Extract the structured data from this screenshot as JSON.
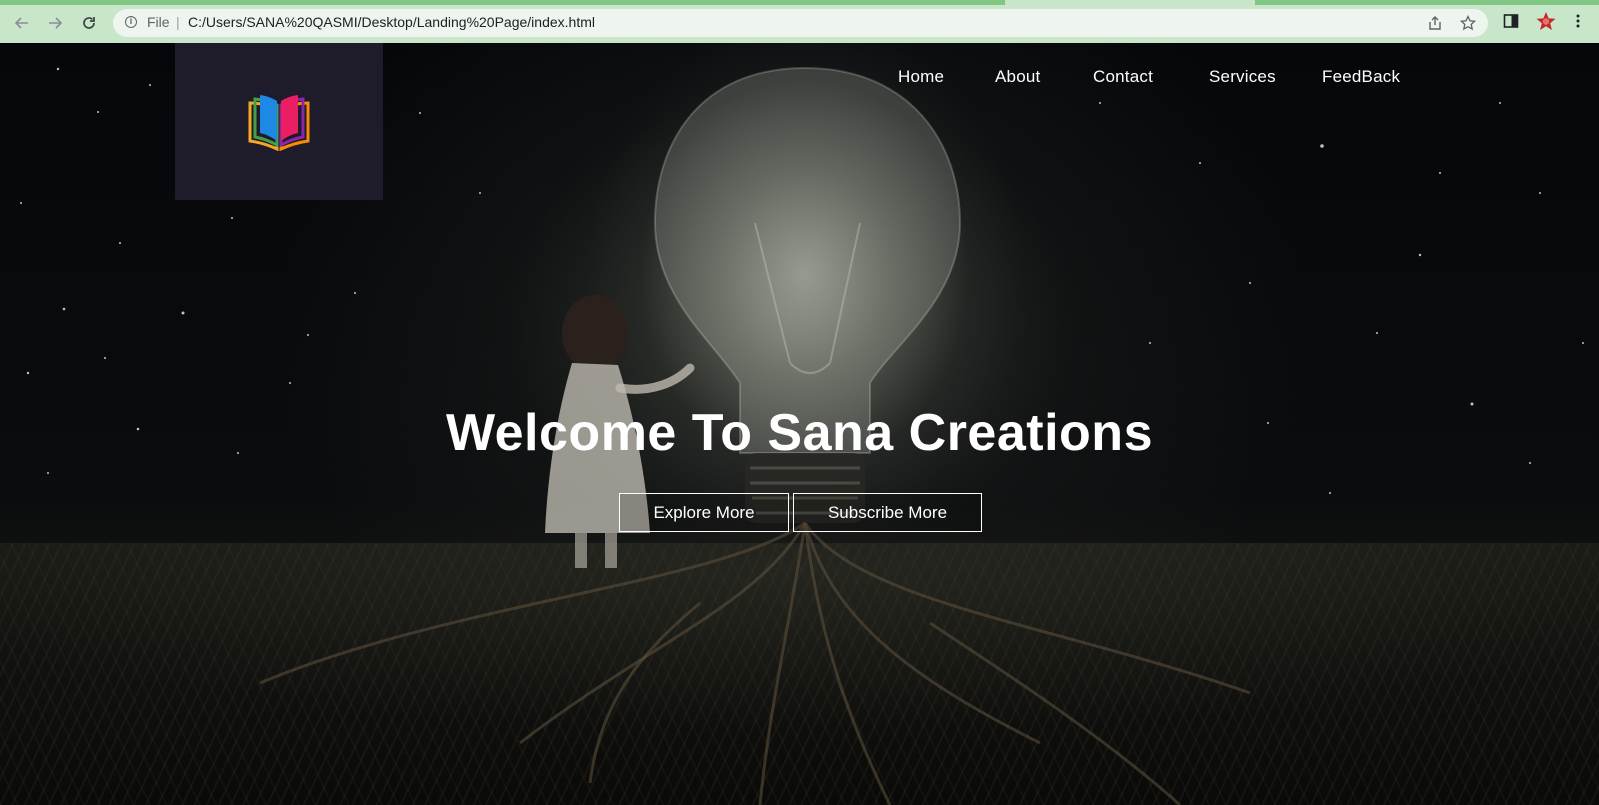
{
  "browser": {
    "scheme_label": "File",
    "url": "C:/Users/SANA%20QASMI/Desktop/Landing%20Page/index.html",
    "icons": [
      "back-arrow-icon",
      "forward-arrow-icon",
      "reload-icon",
      "info-icon",
      "share-icon",
      "star-icon",
      "side-panel-icon",
      "extension-icon",
      "menu-icon"
    ]
  },
  "site": {
    "nav": {
      "home": "Home",
      "about": "About",
      "contact": "Contact",
      "services": "Services",
      "feedback": "FeedBack"
    },
    "hero": {
      "title": "Welcome To Sana Creations",
      "explore_label": "Explore More",
      "subscribe_label": "Subscribe More"
    },
    "colors": {
      "logo_bg": "#1e1b2b",
      "chrome_bg": "#c8e6c9",
      "text": "#ffffff"
    }
  }
}
